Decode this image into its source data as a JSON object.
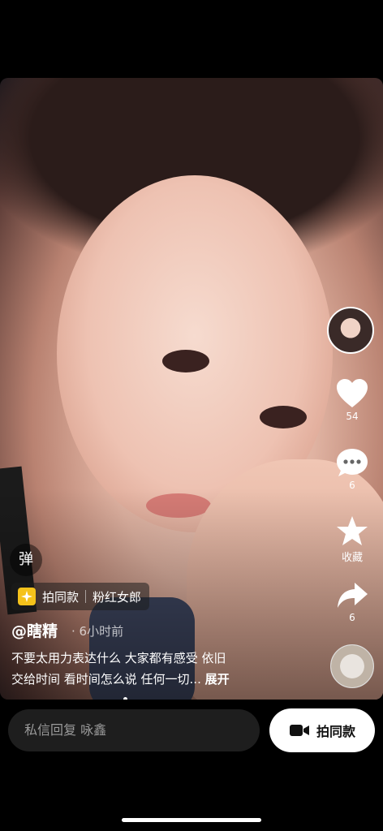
{
  "video": {
    "danmu_label": "弹",
    "tag": {
      "primary": "拍同款",
      "secondary": "粉红女郎"
    },
    "author": "@瞎精",
    "time": "6小时前",
    "caption_line1": "不要太用力表达什么 大家都有感受 依旧",
    "caption_line2": "交给时间 看时间怎么说 任何一切...",
    "caption_more": "展开"
  },
  "sidebar": {
    "likes": "54",
    "comments": "6",
    "favorite_label": "收藏",
    "shares": "6"
  },
  "bottom": {
    "input_placeholder": "私信回复 咏鑫",
    "shoot_same_label": "拍同款"
  },
  "colors": {
    "accent": "#f5c21b",
    "background": "#000000"
  }
}
